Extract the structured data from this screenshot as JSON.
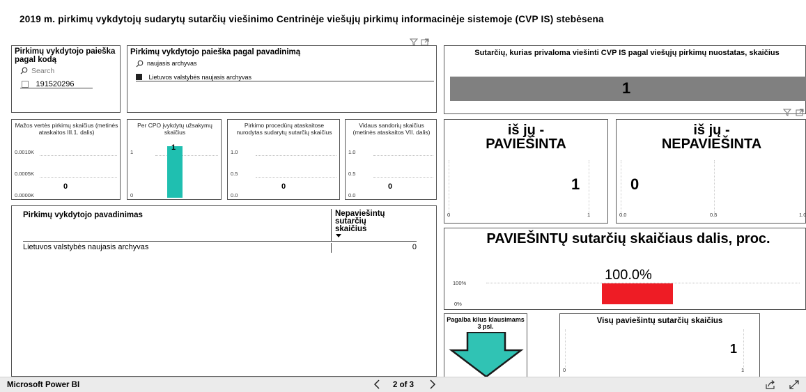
{
  "title": "2019 m. pirkimų vykdytojų sudarytų sutarčių viešinimo Centrinėje viešųjų pirkimų informacinėje sistemoje (CVP IS) stebėsena",
  "search_code": {
    "title": "Pirkimų vykdytojo paieška pagal kodą",
    "placeholder": "Search",
    "item": "191520296"
  },
  "search_name": {
    "title": "Pirkimų vykdytojo paieška pagal pavadinimą",
    "query": "naujasis archyvas",
    "item": "Lietuvos valstybės naujasis archyvas"
  },
  "contracts_required": {
    "title": "Sutarčių, kurias privaloma viešinti CVP IS pagal viešųjų pirkimų nuostatas, skaičius",
    "value": "1"
  },
  "mini_charts": [
    {
      "title": "Mažos vertės pirkimų skaičius (metinės ataskaitos III.1. dalis)",
      "ticks": [
        "0.0010K",
        "0.0005K",
        "0.0000K"
      ],
      "value": "0",
      "bar_fraction": 0
    },
    {
      "title": "Per CPO įvykdytų užsakymų skaičius",
      "ticks": [
        "1",
        "0"
      ],
      "value": "1",
      "bar_fraction": 1
    },
    {
      "title": "Pirkimo procedūrų ataskaitose nurodytas sudarytų sutarčių skaičius",
      "ticks": [
        "1.0",
        "0.5",
        "0.0"
      ],
      "value": "0",
      "bar_fraction": 0
    },
    {
      "title": "Vidaus sandorių skaičius (metinės ataskaitos VII. dalis)",
      "ticks": [
        "1.0",
        "0.5",
        "0.0"
      ],
      "value": "0",
      "bar_fraction": 0
    }
  ],
  "table": {
    "col1": "Pirkimų vykdytojo pavadinimas",
    "col2": "Nepaviešintų sutarčių skaičius",
    "rows": [
      {
        "name": "Lietuvos valstybės naujasis archyvas",
        "value": "0"
      }
    ]
  },
  "published": {
    "line1": "iš jų -",
    "line2": "PAVIEŠINTA",
    "value": "1",
    "axis": [
      "0",
      "1"
    ]
  },
  "unpublished": {
    "line1": "iš jų -",
    "line2": "NEPAVIEŠINTA",
    "value": "0",
    "axis": [
      "0.0",
      "0.5",
      "1.0"
    ]
  },
  "share": {
    "title": "PAVIEŠINTŲ sutarčių skaičiaus dalis, proc.",
    "value": "100.0%",
    "ticks": [
      "100%",
      "0%"
    ],
    "fraction": 1.0
  },
  "help": {
    "label": "Pagalba kilus klausimams 3 psl."
  },
  "total_published": {
    "title": "Visų paviešintų sutarčių skaičius",
    "value": "1",
    "axis": [
      "0",
      "1"
    ]
  },
  "footer": {
    "brand": "Microsoft Power BI",
    "page": "2 of 3"
  },
  "colors": {
    "teal": "#1fbfb0",
    "red": "#ee1c25",
    "gray_bar": "#808080",
    "arrow": "#30c3b4"
  },
  "icons": [
    "filter-icon",
    "focus-mode-icon",
    "search-icon",
    "prev-page-icon",
    "next-page-icon",
    "share-icon",
    "fullscreen-icon"
  ]
}
